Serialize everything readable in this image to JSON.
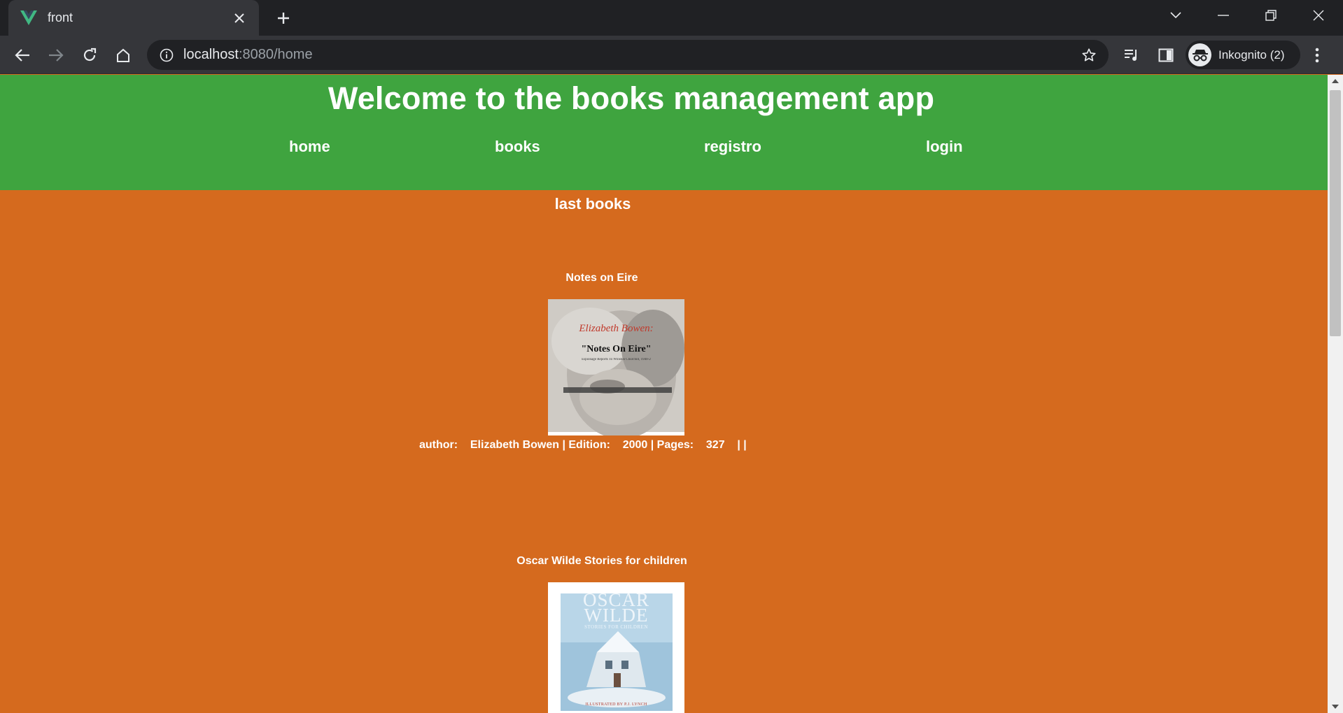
{
  "browser": {
    "tab_title": "front",
    "url_host": "localhost",
    "url_path": ":8080/home",
    "profile_label": "Inkognito (2)"
  },
  "app": {
    "title": "Welcome to the books management app",
    "nav": [
      {
        "label": "home"
      },
      {
        "label": "books"
      },
      {
        "label": "registro"
      },
      {
        "label": "login"
      }
    ],
    "section_title": "last books"
  },
  "books": [
    {
      "title": "Notes on Eire",
      "cover_text": {
        "author": "Elizabeth Bowen:",
        "title": "\"Notes On Eire\"",
        "subtitle": "Espionage Reports To Winston Churchill, 1940-2"
      },
      "meta": "author:    Elizabeth Bowen | Edition:    2000 | Pages:    327    | |"
    },
    {
      "title": "Oscar Wilde Stories for children",
      "cover_text": {
        "line1": "OSCAR",
        "line2": "WILDE",
        "subtitle": "STORIES FOR CHILDREN",
        "footer": "ILLUSTRATED BY P.J. LYNCH"
      }
    }
  ],
  "colors": {
    "header_bg": "#3fa43f",
    "page_bg": "#d56a1e",
    "chrome_dark": "#202124",
    "chrome_mid": "#35363a",
    "vue_green": "#41b883"
  }
}
